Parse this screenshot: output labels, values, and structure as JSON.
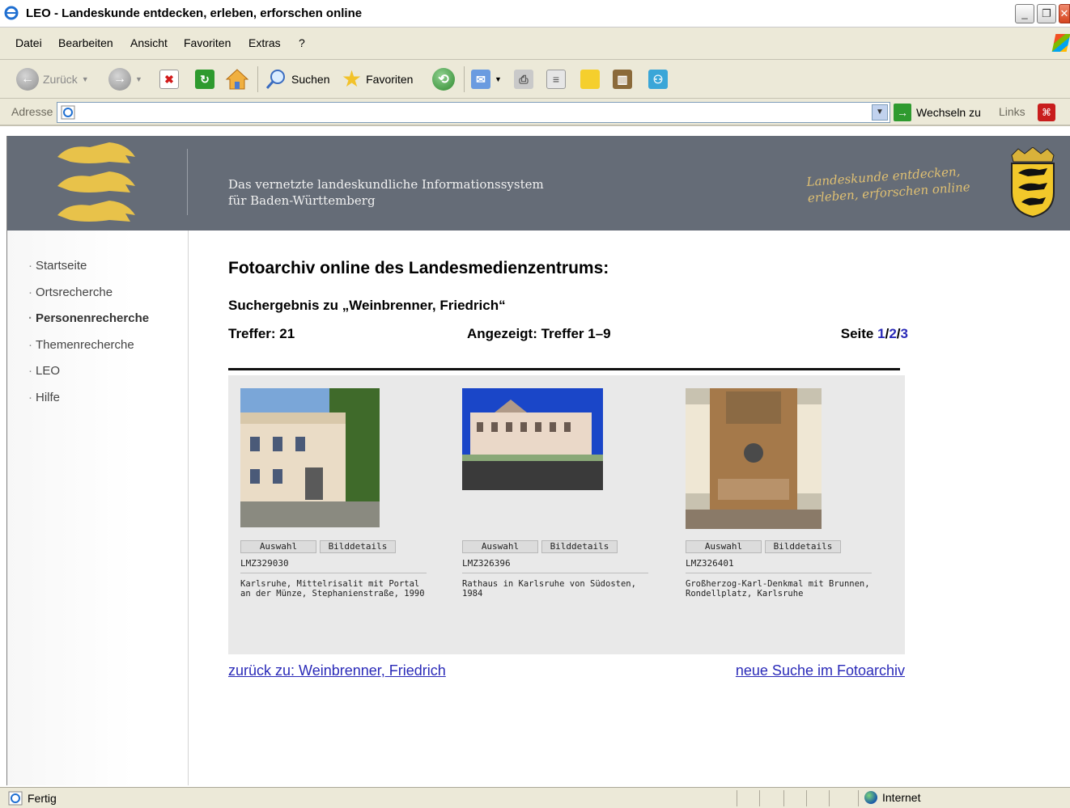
{
  "window": {
    "title": "LEO - Landeskunde entdecken, erleben, erforschen online"
  },
  "menu": [
    "Datei",
    "Bearbeiten",
    "Ansicht",
    "Favoriten",
    "Extras",
    "?"
  ],
  "toolbar": {
    "back_label": "Zurück",
    "search_label": "Suchen",
    "favorites_label": "Favoriten"
  },
  "address": {
    "label": "Adresse",
    "value": "",
    "go_label": "Wechseln zu",
    "links_label": "Links"
  },
  "banner": {
    "tagline_line1": "Das vernetzte landeskundliche Informationssystem",
    "tagline_line2": "für Baden-Württemberg",
    "slogan_line1": "Landeskunde entdecken,",
    "slogan_line2": "erleben, erforschen online"
  },
  "nav": [
    {
      "label": "Startseite",
      "active": false
    },
    {
      "label": "Ortsrecherche",
      "active": false
    },
    {
      "label": "Personenrecherche",
      "active": true
    },
    {
      "label": "Themenrecherche",
      "active": false
    },
    {
      "label": "LEO",
      "active": false
    },
    {
      "label": "Hilfe",
      "active": false
    }
  ],
  "page": {
    "heading": "Fotoarchiv online des Landesmedienzentrums:",
    "subheading": "Suchergebnis zu „Weinbrenner, Friedrich“",
    "hits": "Treffer: 21",
    "shown": "Angezeigt: Treffer 1–9",
    "page_label": "Seite",
    "pages": [
      "1",
      "2",
      "3"
    ],
    "page_sep": "/",
    "back_link": "zurück zu: Weinbrenner, Friedrich",
    "new_search_link": "neue Suche im Fotoarchiv"
  },
  "results": [
    {
      "select_label": "Auswahl",
      "details_label": "Bilddetails",
      "code": "LMZ329030",
      "caption": "Karlsruhe, Mittelrisalit mit Portal an der Münze, Stephanienstraße, 1990"
    },
    {
      "select_label": "Auswahl",
      "details_label": "Bilddetails",
      "code": "LMZ326396",
      "caption": "Rathaus in Karlsruhe von Südosten, 1984"
    },
    {
      "select_label": "Auswahl",
      "details_label": "Bilddetails",
      "code": "LMZ326401",
      "caption": "Großherzog-Karl-Denkmal mit Brunnen, Rondellplatz, Karlsruhe"
    }
  ],
  "status": {
    "text": "Fertig",
    "zone": "Internet"
  },
  "colors": {
    "banner_bg": "#656c77",
    "link": "#2a2ab8",
    "slogan": "#e0c072"
  }
}
